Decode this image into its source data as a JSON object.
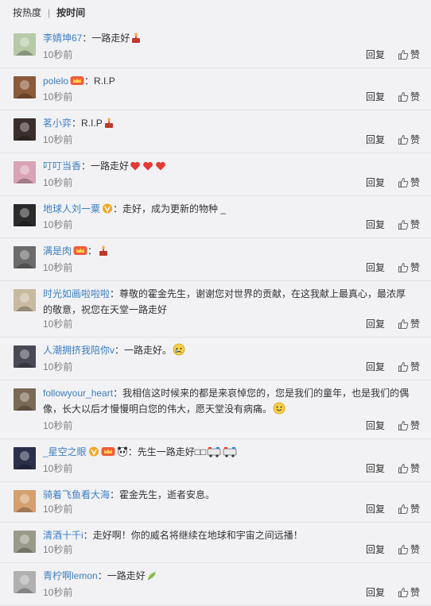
{
  "sort": {
    "hot_label": "按热度",
    "separator": "|",
    "time_label": "按时间"
  },
  "actions": {
    "reply_label": "回复",
    "like_label": "赞"
  },
  "comments": [
    {
      "user": "李婧坤67",
      "separator": "：",
      "text": "一路走好",
      "time": "10秒前",
      "avatar_color": "#b7c9a8",
      "emojis": [
        "candle"
      ]
    },
    {
      "user": "polelo",
      "separator": "：",
      "text": "R.I.P",
      "time": "10秒前",
      "avatar_color": "#8a5a3a",
      "badges": [
        "crown-badge"
      ]
    },
    {
      "user": "茗小弈",
      "separator": "：",
      "text": "R.I.P",
      "time": "10秒前",
      "avatar_color": "#3a2f2a",
      "emojis": [
        "candle"
      ]
    },
    {
      "user": "叮叮当香",
      "separator": "：",
      "text": "一路走好",
      "time": "10秒前",
      "avatar_color": "#d9a3b5",
      "emojis": [
        "heart",
        "heart",
        "heart"
      ]
    },
    {
      "user": "地球人刘一粟",
      "separator": "：",
      "text": "走好，成为更新的物种 _",
      "time": "10秒前",
      "avatar_color": "#2b2b2b",
      "badges": [
        "v-badge"
      ]
    },
    {
      "user": "满是肉",
      "separator": "：",
      "text": "",
      "time": "10秒前",
      "avatar_color": "#6b6b6b",
      "badges": [
        "crown-badge"
      ],
      "emojis": [
        "candle"
      ]
    },
    {
      "user": "时光如画啦啦啦",
      "separator": "：",
      "text": "尊敬的霍金先生，谢谢您对世界的贡献，在这我献上最真心，最浓厚的敬意，祝您在天堂一路走好",
      "time": "10秒前",
      "avatar_color": "#c9b9a0"
    },
    {
      "user": "人潮拥挤我陪你v",
      "separator": "：",
      "text": "一路走好。",
      "time": "10秒前",
      "avatar_color": "#4a4a55",
      "emojis": [
        "cry"
      ]
    },
    {
      "user": "followyour_heart",
      "separator": "：",
      "text": "我相信这时候来的都是来哀悼您的，您是我们的童年，也是我们的偶像，长大以后才慢慢明白您的伟大，愿天堂没有病痛。",
      "time": "10秒前",
      "avatar_color": "#7a6a55",
      "emojis": [
        "smile"
      ]
    },
    {
      "user": "_星空之眼",
      "separator": "：",
      "text": "先生一路走好□□",
      "time": "10秒前",
      "avatar_color": "#2a2f4a",
      "badges": [
        "v-badge",
        "crown-badge",
        "panda-badge"
      ],
      "emojis": [
        "ambulance",
        "ambulance"
      ]
    },
    {
      "user": "骑着飞鱼看大海",
      "separator": "：",
      "text": "霍金先生，逝者安息。",
      "time": "10秒前",
      "avatar_color": "#d4a070"
    },
    {
      "user": "清酒十千i",
      "separator": "：",
      "text": "走好啊！你的威名将继续在地球和宇宙之间远播！",
      "time": "10秒前",
      "avatar_color": "#9a9a8a"
    },
    {
      "user": "青柠啊lemon",
      "separator": "：",
      "text": "一路走好",
      "time": "10秒前",
      "avatar_color": "#b0b0b0",
      "emojis": [
        "leaf"
      ]
    }
  ],
  "colors": {
    "link": "#3d7ec2",
    "time": "#808080",
    "background": "#f2f2f5",
    "divider": "#e3e3e6"
  }
}
